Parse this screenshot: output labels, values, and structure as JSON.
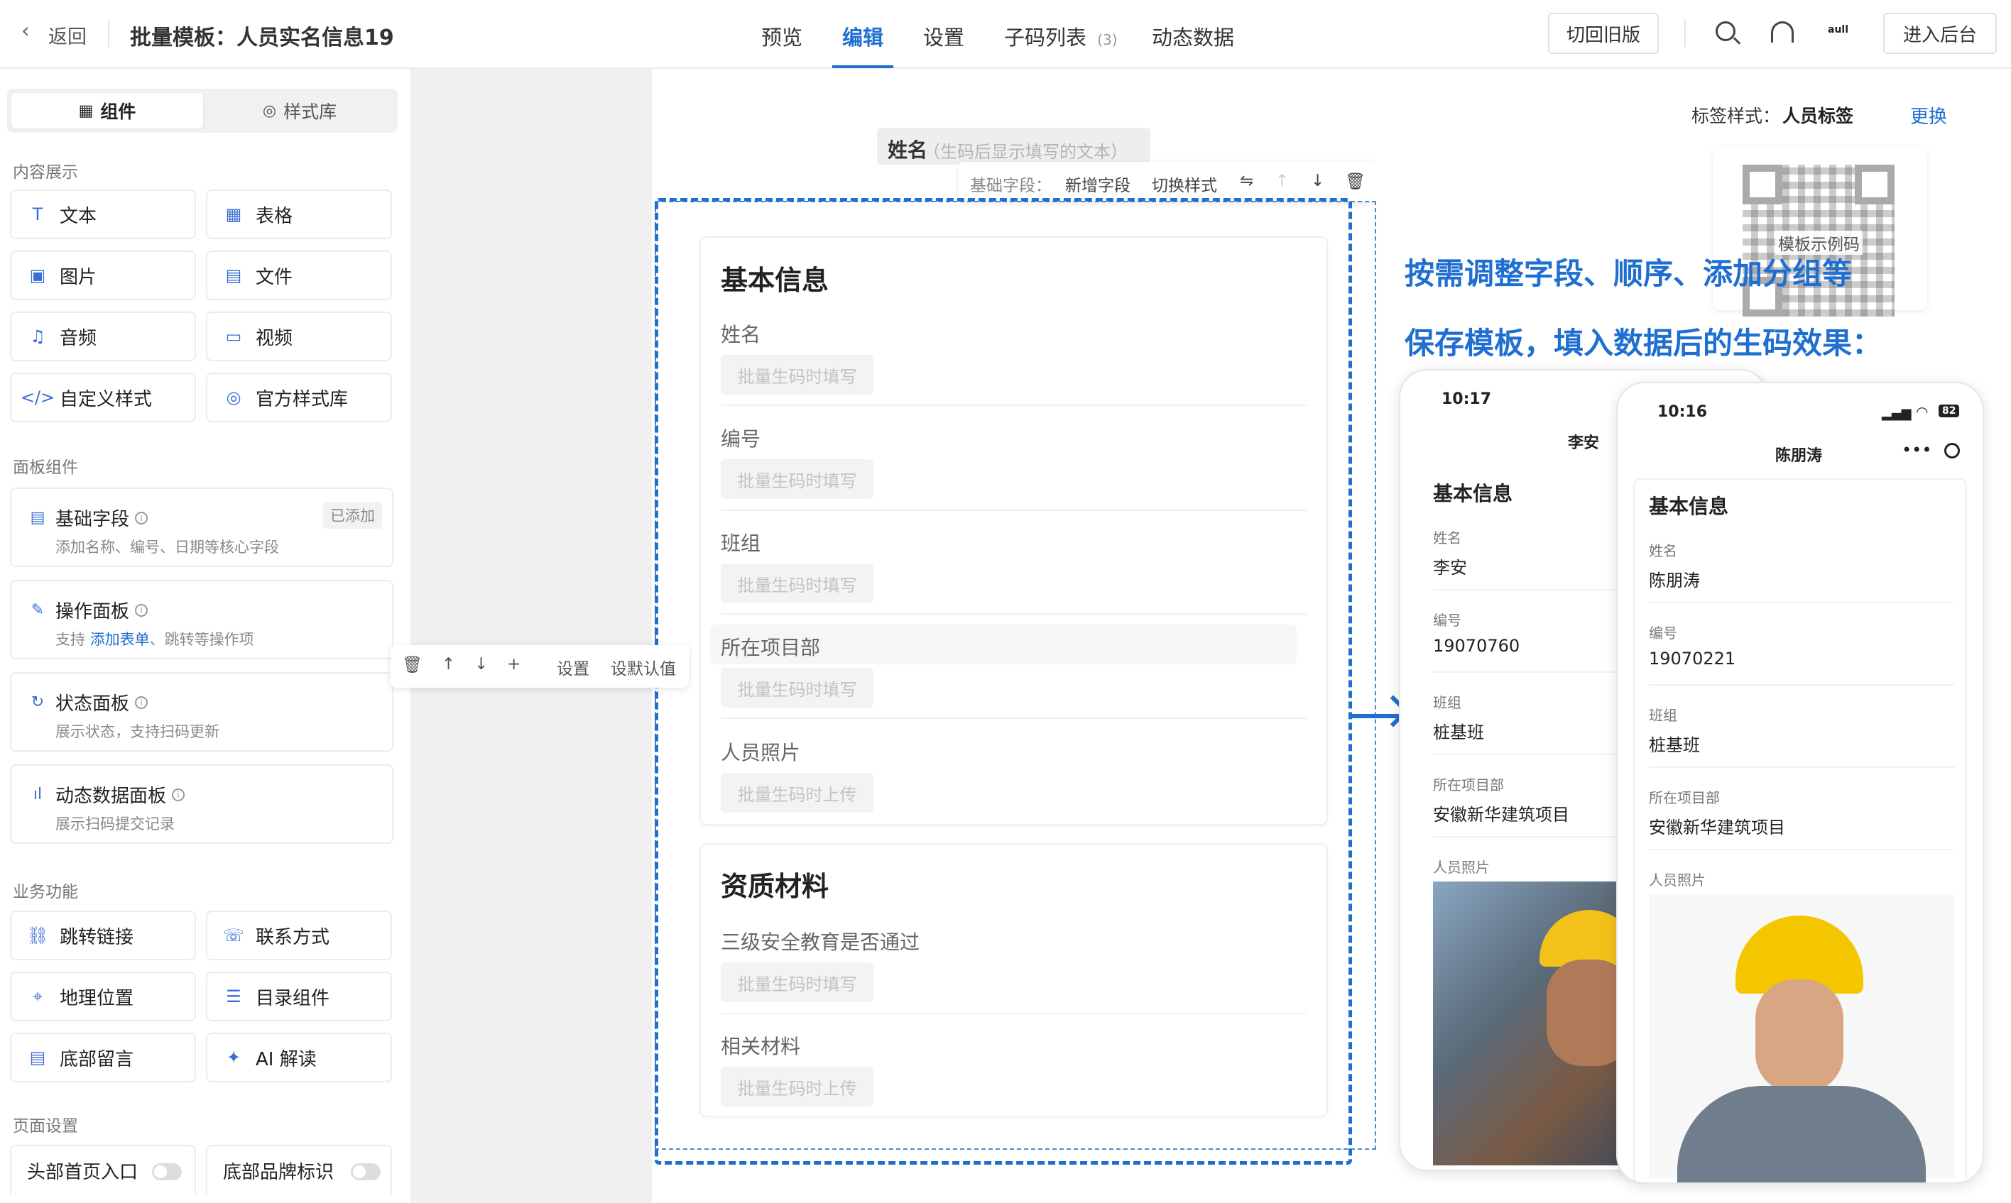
{
  "header": {
    "back": "返回",
    "title": "批量模板：人员实名信息19",
    "tabs": [
      {
        "label": "预览"
      },
      {
        "label": "编辑"
      },
      {
        "label": "设置"
      },
      {
        "label": "子码列表",
        "count": "(3)"
      },
      {
        "label": "动态数据"
      }
    ],
    "old_version": "切回旧版",
    "backend": "进入后台"
  },
  "left": {
    "tabs": [
      "组件",
      "样式库"
    ],
    "sections": [
      "内容展示",
      "面板组件",
      "业务功能",
      "页面设置"
    ],
    "content_items": [
      "文本",
      "表格",
      "图片",
      "文件",
      "音频",
      "视频",
      "自定义样式",
      "官方样式库"
    ],
    "panels": [
      {
        "title": "基础字段",
        "desc": "添加名称、编号、日期等核心字段",
        "badge": "已添加"
      },
      {
        "title": "操作面板",
        "desc_pre": "支持",
        "desc_link": "添加表单",
        "desc_post": "、跳转等操作项"
      },
      {
        "title": "状态面板",
        "desc": "展示状态，支持扫码更新"
      },
      {
        "title": "动态数据面板",
        "desc": "展示扫码提交记录"
      }
    ],
    "biz_items": [
      "跳转链接",
      "联系方式",
      "地理位置",
      "目录组件",
      "底部留言",
      "AI 解读"
    ],
    "page_settings": [
      "头部首页入口",
      "底部品牌标识"
    ]
  },
  "editor": {
    "title_chip": "姓名",
    "title_chip_hint": "（生码后显示填写的文本）",
    "top_toolbar": [
      "基础字段：",
      "新增字段",
      "切换样式"
    ],
    "float_toolbar": [
      "设置",
      "设默认值"
    ],
    "sections": [
      {
        "title": "基本信息",
        "fields": [
          {
            "label": "姓名",
            "placeholder": "批量生码时填写"
          },
          {
            "label": "编号",
            "placeholder": "批量生码时填写"
          },
          {
            "label": "班组",
            "placeholder": "批量生码时填写"
          },
          {
            "label": "所在项目部",
            "placeholder": "批量生码时填写"
          },
          {
            "label": "人员照片",
            "placeholder": "批量生码时上传"
          }
        ]
      },
      {
        "title": "资质材料",
        "fields": [
          {
            "label": "三级安全教育是否通过",
            "placeholder": "批量生码时填写"
          },
          {
            "label": "相关材料",
            "placeholder": "批量生码时上传"
          }
        ]
      }
    ]
  },
  "right": {
    "label_style_prefix": "标签样式：",
    "label_style_value": "人员标签",
    "change": "更换",
    "qr_caption": "模板示例码",
    "promo_line1": "按需调整字段、顺序、添加分组等",
    "promo_line2": "保存模板，填入数据后的生码效果：",
    "phone_back": {
      "time": "10:17",
      "name": "李安",
      "section": "基本信息",
      "fields": [
        {
          "label": "姓名",
          "value": "李安"
        },
        {
          "label": "编号",
          "value": "19070760"
        },
        {
          "label": "班组",
          "value": "桩基班"
        },
        {
          "label": "所在项目部",
          "value": "安徽新华建筑项目"
        },
        {
          "label": "人员照片",
          "value": ""
        }
      ]
    },
    "phone_front": {
      "time": "10:16",
      "battery": "82",
      "name": "陈朋涛",
      "section": "基本信息",
      "fields": [
        {
          "label": "姓名",
          "value": "陈朋涛"
        },
        {
          "label": "编号",
          "value": "19070221"
        },
        {
          "label": "班组",
          "value": "桩基班"
        },
        {
          "label": "所在项目部",
          "value": "安徽新华建筑项目"
        },
        {
          "label": "人员照片",
          "value": ""
        }
      ]
    }
  },
  "colors": {
    "accent": "#1f6fd1",
    "tab_active": "#1f6fd1",
    "dashed": "#1f6fd1"
  }
}
